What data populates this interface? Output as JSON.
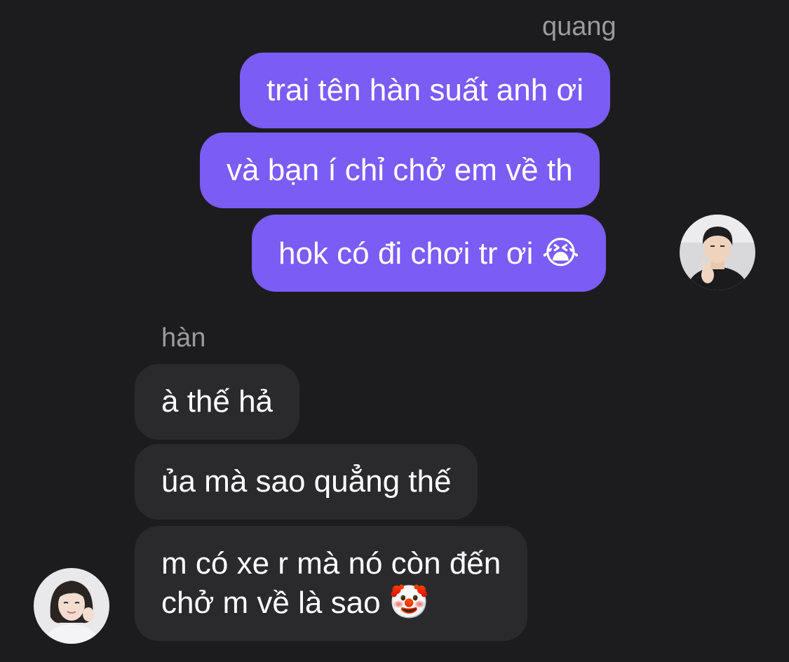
{
  "chat": {
    "outgoing_sender": "quang",
    "incoming_sender": "hàn",
    "outgoing_messages": [
      {
        "text": "trai tên hàn suất anh ơi",
        "emoji": ""
      },
      {
        "text": "và bạn í chỉ chở em về th",
        "emoji": ""
      },
      {
        "text": "hok có đi chơi tr ơi",
        "emoji": "😭"
      }
    ],
    "incoming_messages": [
      {
        "text": "à thế hả",
        "emoji": ""
      },
      {
        "text": "ủa mà sao quẳng thế",
        "emoji": ""
      },
      {
        "line1": "m có xe r mà nó còn đến",
        "line2": "chở m về là sao",
        "emoji": "🤡"
      }
    ]
  },
  "colors": {
    "background": "#1c1c1e",
    "outgoing_bubble": "#7b5cf5",
    "incoming_bubble": "#2a2a2d",
    "sender_name": "#9a9a9f",
    "message_text": "#ffffff"
  },
  "icons": {
    "outgoing_avatar": "avatar-quang",
    "incoming_avatar": "avatar-han"
  }
}
